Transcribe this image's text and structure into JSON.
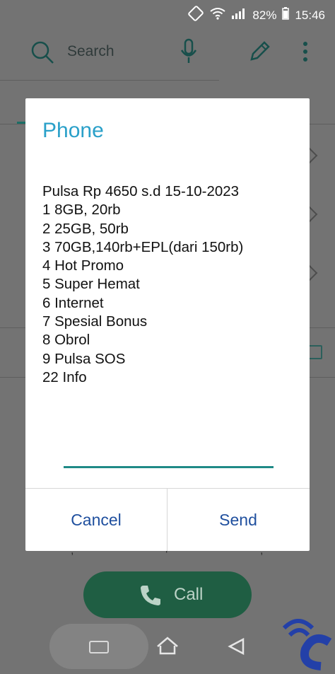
{
  "status_bar": {
    "battery": "82%",
    "time": "15:46"
  },
  "toolbar": {
    "search_placeholder": "Search"
  },
  "dialpad": {
    "chars": [
      ",",
      "+",
      ";"
    ]
  },
  "call_button": {
    "label": "Call"
  },
  "dialog": {
    "title": "Phone",
    "lines": [
      "Pulsa Rp 4650 s.d 15-10-2023",
      "1 8GB, 20rb",
      "2 25GB, 50rb",
      "3 70GB,140rb+EPL(dari 150rb)",
      "4 Hot Promo",
      "5 Super Hemat",
      "6 Internet",
      "7 Spesial Bonus",
      "8 Obrol",
      "9 Pulsa SOS",
      "22 Info"
    ],
    "input_value": "",
    "cancel_label": "Cancel",
    "send_label": "Send"
  },
  "colors": {
    "accent": "#2aa0c9",
    "button_text": "#1f4f9e",
    "input_underline": "#1f8a86",
    "call_button_bg": "#1f5e43"
  }
}
